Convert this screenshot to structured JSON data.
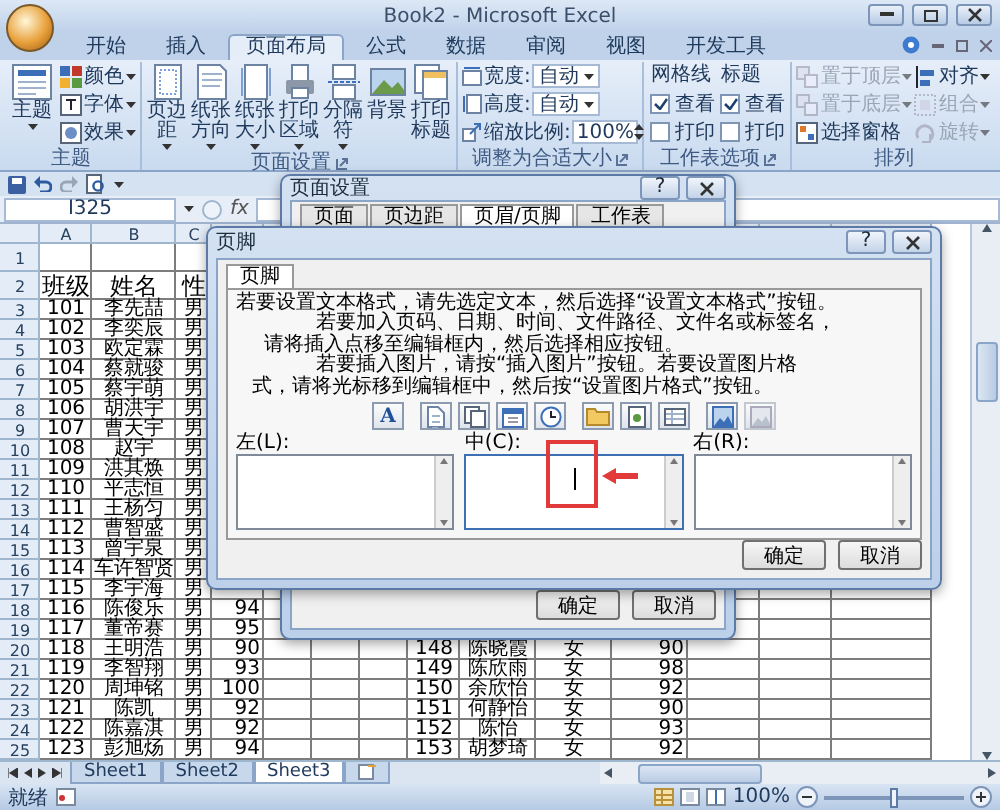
{
  "window": {
    "title": "Book2 - Microsoft Excel"
  },
  "ribbon_tabs": [
    {
      "label": "开始",
      "selected": false
    },
    {
      "label": "插入",
      "selected": false
    },
    {
      "label": "页面布局",
      "selected": true
    },
    {
      "label": "公式",
      "selected": false
    },
    {
      "label": "数据",
      "selected": false
    },
    {
      "label": "审阅",
      "selected": false
    },
    {
      "label": "视图",
      "selected": false
    },
    {
      "label": "开发工具",
      "selected": false
    }
  ],
  "ribbon": {
    "theme": {
      "label": "主题",
      "group": "主题",
      "items": [
        {
          "label": "颜色",
          "kind": "colors"
        },
        {
          "label": "字体",
          "kind": "fonts"
        },
        {
          "label": "效果",
          "kind": "effects"
        }
      ]
    },
    "page_setup": {
      "group": "页面设置",
      "buttons": [
        {
          "label": "页边距",
          "kind": "margins",
          "dropdown": true
        },
        {
          "label": "纸张方向",
          "kind": "orientation",
          "dropdown": true
        },
        {
          "label": "纸张大小",
          "kind": "size",
          "dropdown": true
        },
        {
          "label": "打印区域",
          "kind": "print-area",
          "dropdown": true
        },
        {
          "label": "分隔符",
          "kind": "breaks",
          "dropdown": true
        },
        {
          "label": "背景",
          "kind": "background",
          "dropdown": false
        },
        {
          "label": "打印标题",
          "kind": "print-titles",
          "dropdown": false
        }
      ]
    },
    "scale": {
      "group": "调整为合适大小",
      "width_label": "宽度:",
      "width": "自动",
      "height_label": "高度:",
      "height": "自动",
      "scale_label": "缩放比例:",
      "scale": "100%"
    },
    "sheet_options": {
      "group": "工作表选项",
      "columns": [
        {
          "title": "网格线",
          "view": {
            "label": "查看",
            "checked": true
          },
          "print": {
            "label": "打印",
            "checked": false
          }
        },
        {
          "title": "标题",
          "view": {
            "label": "查看",
            "checked": true
          },
          "print": {
            "label": "打印",
            "checked": false
          }
        }
      ]
    },
    "arrange": {
      "group": "排列",
      "items": [
        {
          "label": "置于顶层",
          "kind": "front",
          "disabled": true,
          "dropdown": true
        },
        {
          "label": "置于底层",
          "kind": "back",
          "disabled": true,
          "dropdown": true
        },
        {
          "label": "选择窗格",
          "kind": "pane",
          "disabled": false,
          "dropdown": false
        },
        {
          "label": "对齐",
          "kind": "align",
          "disabled": false,
          "dropdown": true
        },
        {
          "label": "组合",
          "kind": "group",
          "disabled": true,
          "dropdown": true
        },
        {
          "label": "旋转",
          "kind": "rotate",
          "disabled": true,
          "dropdown": true
        }
      ]
    }
  },
  "name_box": "I325",
  "formula_label": "fx",
  "sheet": {
    "columns": [
      "A",
      "B",
      "C"
    ],
    "rows": [
      {
        "number": "1",
        "cells": {}
      },
      {
        "number": "2",
        "cells": {
          "A": "班级",
          "B": "姓名",
          "C": "性"
        }
      },
      {
        "number": "3",
        "cells": {
          "A": "101",
          "B": "李先喆",
          "C": "男"
        }
      },
      {
        "number": "4",
        "cells": {
          "A": "102",
          "B": "李奕辰",
          "C": "男"
        }
      },
      {
        "number": "5",
        "cells": {
          "A": "103",
          "B": "欧定霖",
          "C": "男"
        }
      },
      {
        "number": "6",
        "cells": {
          "A": "104",
          "B": "蔡就骏",
          "C": "男"
        }
      },
      {
        "number": "7",
        "cells": {
          "A": "105",
          "B": "蔡宇萌",
          "C": "男"
        }
      },
      {
        "number": "8",
        "cells": {
          "A": "106",
          "B": "胡洪宇",
          "C": "男"
        }
      },
      {
        "number": "9",
        "cells": {
          "A": "107",
          "B": "曹天宇",
          "C": "男"
        }
      },
      {
        "number": "10",
        "cells": {
          "A": "108",
          "B": "赵宇",
          "C": "男"
        }
      },
      {
        "number": "11",
        "cells": {
          "A": "109",
          "B": "洪其焕",
          "C": "男"
        }
      },
      {
        "number": "12",
        "cells": {
          "A": "110",
          "B": "平志恒",
          "C": "男"
        }
      },
      {
        "number": "13",
        "cells": {
          "A": "111",
          "B": "王杨匀",
          "C": "男"
        }
      },
      {
        "number": "14",
        "cells": {
          "A": "112",
          "B": "曹智盛",
          "C": "男"
        }
      },
      {
        "number": "15",
        "cells": {
          "A": "113",
          "B": "曾宇泉",
          "C": "男"
        }
      },
      {
        "number": "16",
        "cells": {
          "A": "114",
          "B": "车许智贤",
          "C": "男"
        }
      },
      {
        "number": "17",
        "cells": {
          "A": "115",
          "B": "李宇海",
          "C": "男"
        }
      },
      {
        "number": "18",
        "cells": {
          "A": "116",
          "B": "陈俊乐",
          "C": "男",
          "D": "94"
        }
      },
      {
        "number": "19",
        "cells": {
          "A": "117",
          "B": "董帝赛",
          "C": "男",
          "D": "95"
        }
      },
      {
        "number": "20",
        "cells": {
          "A": "118",
          "B": "王明浩",
          "C": "男",
          "D": "90",
          "H": "148",
          "I": "陈晓霞",
          "J": "女",
          "K": "90"
        }
      },
      {
        "number": "21",
        "cells": {
          "A": "119",
          "B": "李智翔",
          "C": "男",
          "D": "93",
          "H": "149",
          "I": "陈欣雨",
          "J": "女",
          "K": "98"
        }
      },
      {
        "number": "22",
        "cells": {
          "A": "120",
          "B": "周坤铭",
          "C": "男",
          "D": "100",
          "H": "150",
          "I": "余欣怡",
          "J": "女",
          "K": "92"
        }
      },
      {
        "number": "23",
        "cells": {
          "A": "121",
          "B": "陈凯",
          "C": "男",
          "D": "92",
          "H": "151",
          "I": "何静怡",
          "J": "女",
          "K": "90"
        }
      },
      {
        "number": "24",
        "cells": {
          "A": "122",
          "B": "陈嘉淇",
          "C": "男",
          "D": "92",
          "H": "152",
          "I": "陈怡",
          "J": "女",
          "K": "93"
        }
      },
      {
        "number": "25",
        "cells": {
          "A": "123",
          "B": "彭旭炀",
          "C": "男",
          "D": "94",
          "H": "153",
          "I": "胡梦琦",
          "J": "女",
          "K": "92"
        }
      }
    ]
  },
  "sheet_tabs": [
    {
      "label": "Sheet1",
      "selected": false
    },
    {
      "label": "Sheet2",
      "selected": false
    },
    {
      "label": "Sheet3",
      "selected": true
    }
  ],
  "status_bar": {
    "text": "就绪",
    "zoom": "100%",
    "zoom_slider": {
      "level": 0.5
    }
  },
  "page_setup_dialog": {
    "title": "页面设置",
    "help": "?",
    "tabs": [
      {
        "label": "页面",
        "selected": false
      },
      {
        "label": "页边距",
        "selected": false
      },
      {
        "label": "页眉/页脚",
        "selected": true
      },
      {
        "label": "工作表",
        "selected": false
      }
    ],
    "buttons": [
      "确定",
      "取消"
    ]
  },
  "footer_dialog": {
    "title": "页脚",
    "help": "?",
    "tab": "页脚",
    "instructions": [
      "若要设置文本格式，请先选定文本，然后选择“设置文本格式”按钮。",
      "若要加入页码、日期、时间、文件路径、文件名或标签名，",
      "请将插入点移至编辑框内，然后选择相应按钮。",
      "若要插入图片，请按“插入图片”按钮。若要设置图片格",
      "式，请将光标移到编辑框中，然后按“设置图片格式”按钮。"
    ],
    "tools": [
      {
        "kind": "text-format",
        "label": "A",
        "disabled": false
      },
      {
        "kind": "page-number",
        "disabled": false
      },
      {
        "kind": "page-count",
        "disabled": false
      },
      {
        "kind": "date",
        "disabled": false
      },
      {
        "kind": "time",
        "disabled": false
      },
      {
        "kind": "file-path",
        "disabled": false
      },
      {
        "kind": "file-name",
        "disabled": false
      },
      {
        "kind": "sheet-name",
        "disabled": false
      },
      {
        "kind": "picture",
        "disabled": false
      },
      {
        "kind": "picture-format",
        "disabled": true
      }
    ],
    "sections": [
      {
        "label": "左(L):",
        "focused": false
      },
      {
        "label": "中(C):",
        "focused": true
      },
      {
        "label": "右(R):",
        "focused": false
      }
    ],
    "buttons": [
      "确定",
      "取消"
    ]
  }
}
